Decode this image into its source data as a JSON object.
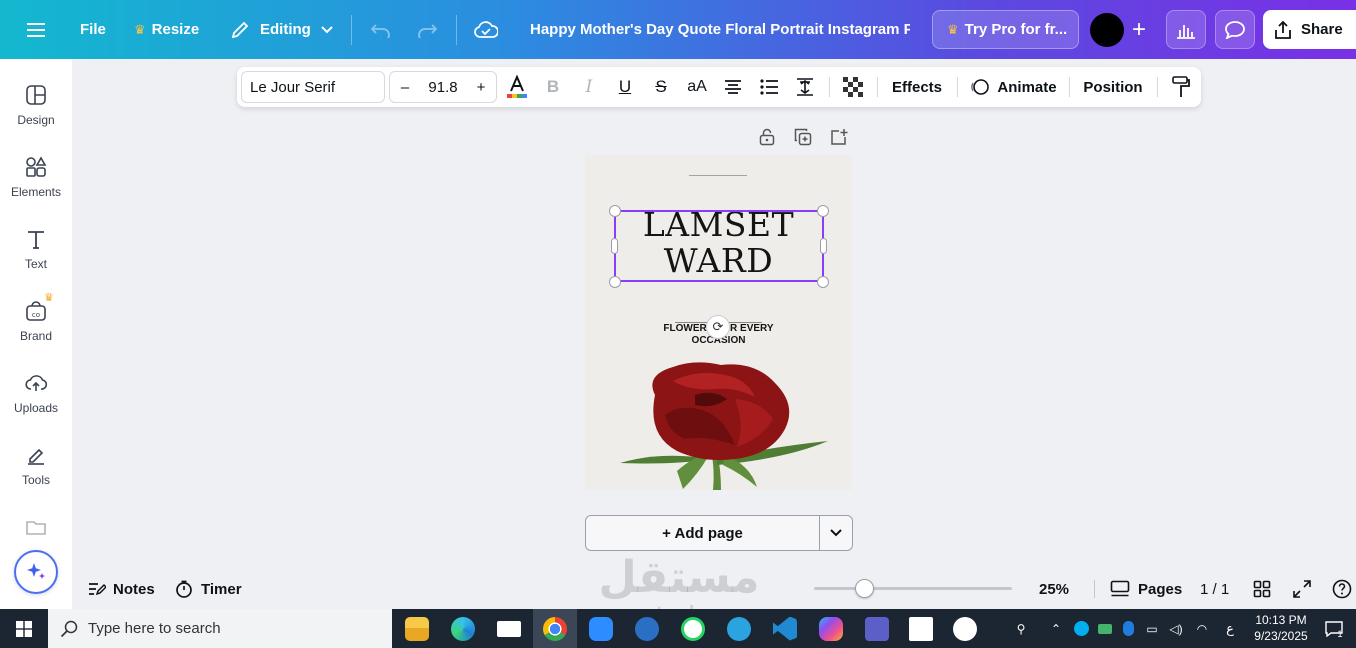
{
  "topbar": {
    "file_label": "File",
    "resize_label": "Resize",
    "editing_label": "Editing",
    "document_title": "Happy Mother's Day Quote Floral Portrait Instagram P...",
    "pro_label": "Try Pro for fr...",
    "share_label": "Share",
    "avatar_color": "#000000"
  },
  "sidebar": {
    "items": [
      {
        "label": "Design",
        "icon": "design-icon"
      },
      {
        "label": "Elements",
        "icon": "elements-icon"
      },
      {
        "label": "Text",
        "icon": "text-icon"
      },
      {
        "label": "Brand",
        "icon": "brand-icon"
      },
      {
        "label": "Uploads",
        "icon": "uploads-icon"
      },
      {
        "label": "Tools",
        "icon": "tools-icon"
      }
    ]
  },
  "text_toolbar": {
    "font_name": "Le Jour Serif",
    "font_size": "91.8",
    "minus_label": "–",
    "plus_label": "+",
    "bold_label": "B",
    "italic_label": "I",
    "underline_label": "U",
    "strike_label": "S",
    "case_label": "aA",
    "effects_label": "Effects",
    "animate_label": "Animate",
    "position_label": "Position"
  },
  "canvas": {
    "title_line1": "LAMSET",
    "title_line2": "WARD",
    "subtitle": "FLOWERS FOR EVERY OCCASION",
    "background_color": "#efede9",
    "selection_color": "#8b3dff"
  },
  "add_page_label": "+ Add page",
  "bottombar": {
    "notes_label": "Notes",
    "timer_label": "Timer",
    "zoom_value": "25%",
    "zoom_level": 0.25,
    "pages_label": "Pages",
    "page_counter": "1 / 1"
  },
  "watermark": {
    "arabic": "مستقل",
    "latin": "mostaql.com"
  },
  "taskbar": {
    "search_placeholder": "Type here to search",
    "language": "ع",
    "time": "10:13 PM",
    "date": "9/23/2025",
    "notification_count": "1"
  }
}
